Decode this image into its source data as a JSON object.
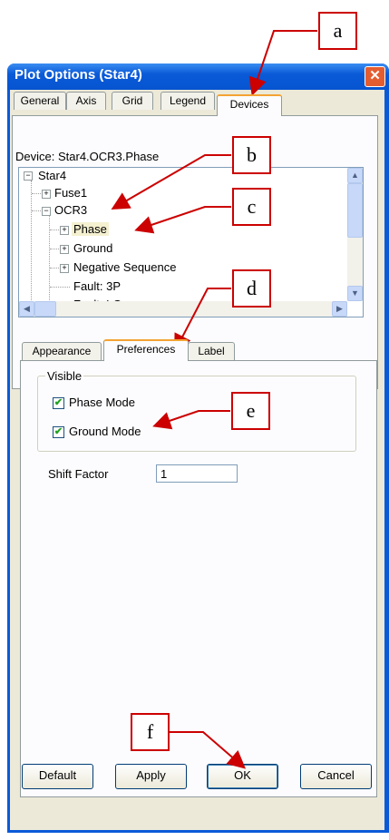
{
  "dialog": {
    "title": "Plot Options (Star4)",
    "close_glyph": "✕"
  },
  "main_tabs": [
    {
      "label": "General"
    },
    {
      "label": "Axis"
    },
    {
      "label": "Grid"
    },
    {
      "label": "Legend"
    },
    {
      "label": "Devices",
      "active": true
    }
  ],
  "device": {
    "label": "Device:",
    "value": "Star4.OCR3.Phase"
  },
  "tree": {
    "items": [
      {
        "label": "Star4",
        "expander": "⊟"
      },
      {
        "label": "Fuse1",
        "expander": "+"
      },
      {
        "label": "OCR3",
        "expander": "−"
      },
      {
        "label": "Phase",
        "expander": "+",
        "selected": true
      },
      {
        "label": "Ground",
        "expander": "+"
      },
      {
        "label": "Negative Sequence",
        "expander": "+"
      },
      {
        "label": "Fault: 3P"
      },
      {
        "label": "Fault: LG"
      }
    ]
  },
  "sub_tabs": [
    {
      "label": "Appearance"
    },
    {
      "label": "Preferences",
      "active": true
    },
    {
      "label": "Label"
    }
  ],
  "visible_group": {
    "legend": "Visible",
    "phase_mode": {
      "label": "Phase Mode",
      "checked": true,
      "mark": "✔"
    },
    "ground_mode": {
      "label": "Ground Mode",
      "checked": true,
      "mark": "✔"
    }
  },
  "shift_factor": {
    "label": "Shift Factor",
    "value": "1"
  },
  "buttons": {
    "default": "Default",
    "apply": "Apply",
    "ok": "OK",
    "cancel": "Cancel"
  },
  "callouts": [
    "a",
    "b",
    "c",
    "d",
    "e",
    "f"
  ],
  "scroll_glyphs": {
    "up": "▲",
    "down": "▼",
    "left": "◀",
    "right": "▶"
  },
  "colors": {
    "accent_red": "#cc0000",
    "title_blue": "#0a5ad8",
    "tab_highlight": "#f3a333"
  }
}
